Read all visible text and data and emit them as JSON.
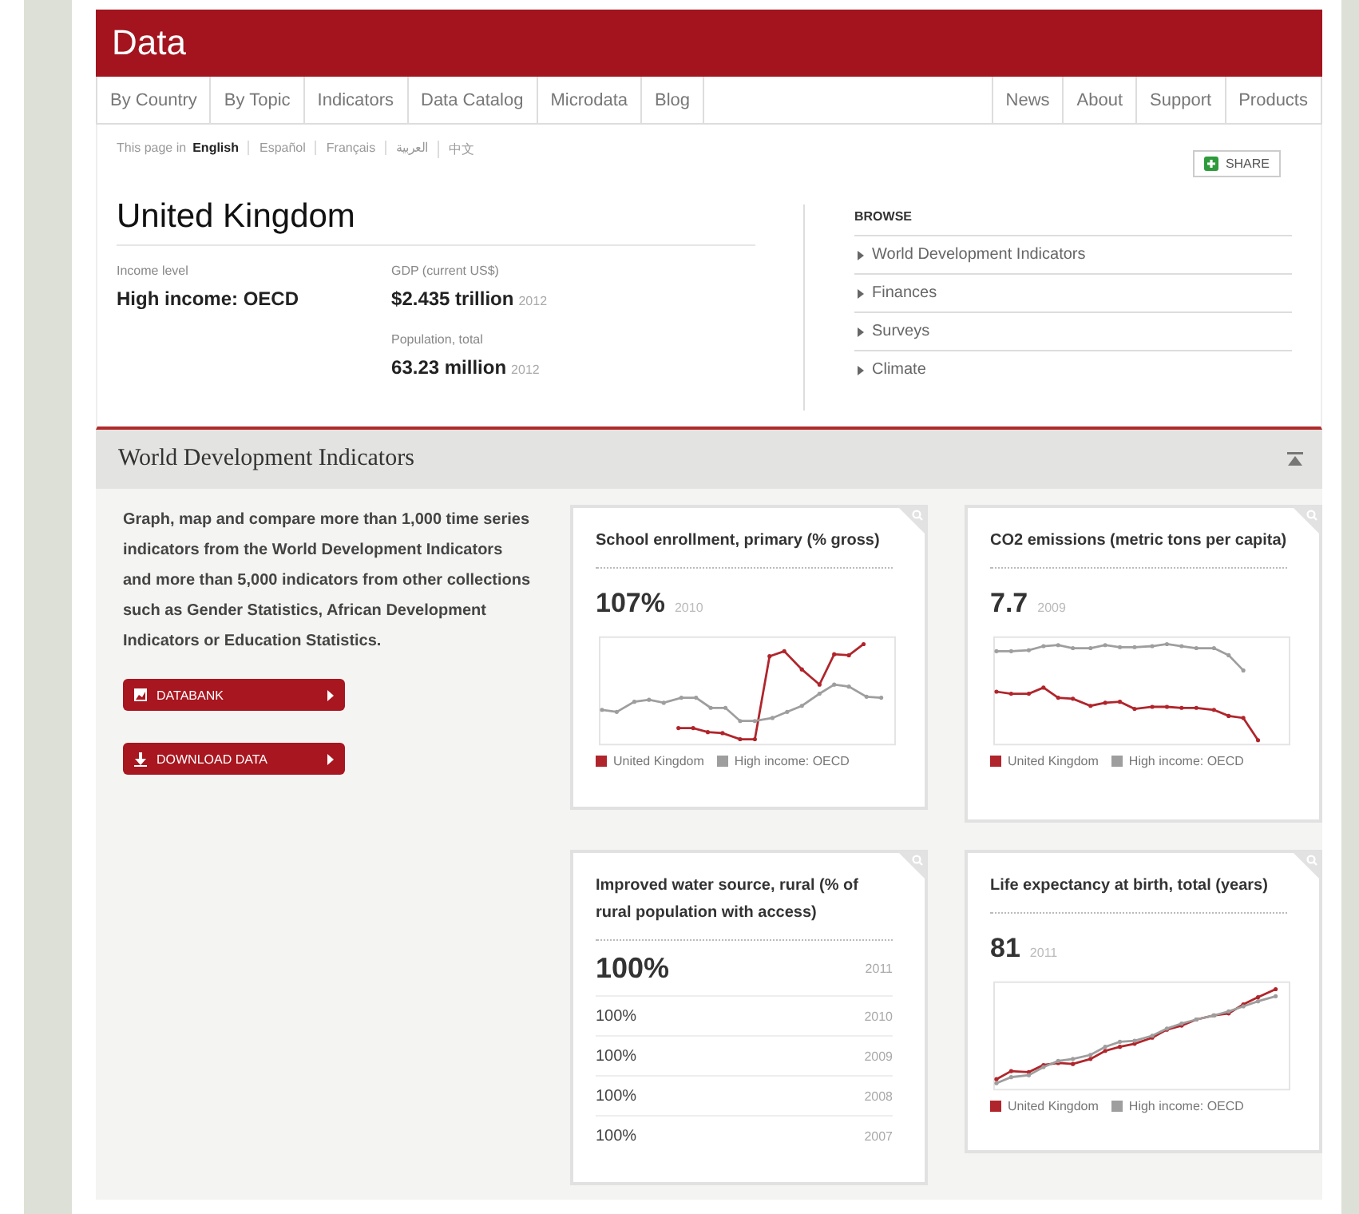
{
  "header": {
    "title": "Data"
  },
  "nav": {
    "left": [
      "By Country",
      "By Topic",
      "Indicators",
      "Data Catalog",
      "Microdata",
      "Blog"
    ],
    "right": [
      "News",
      "About",
      "Support",
      "Products"
    ]
  },
  "languages": {
    "label": "This page in",
    "items": [
      {
        "label": "English",
        "selected": true
      },
      {
        "label": "Español",
        "selected": false
      },
      {
        "label": "Français",
        "selected": false
      },
      {
        "label": "العربية",
        "selected": false
      },
      {
        "label": "中文",
        "selected": false
      }
    ]
  },
  "share": "SHARE",
  "country": {
    "name": "United Kingdom",
    "columns": [
      [
        {
          "label": "Income level",
          "value": "High income: OECD"
        }
      ],
      [
        {
          "label": "GDP (current US$)",
          "value": "$2.435 trillion",
          "year": "2012"
        },
        {
          "label": "Population, total",
          "value": "63.23 million",
          "year": "2012"
        }
      ]
    ]
  },
  "browse": {
    "title": "BROWSE",
    "items": [
      "World Development Indicators",
      "Finances",
      "Surveys",
      "Climate"
    ]
  },
  "section": {
    "title": "World Development Indicators",
    "expanded": true,
    "description": "Graph, map and compare more than 1,000 time series indicators from the World Development Indicators and more than 5,000 indicators from other collections such as Gender Statistics, African Development Indicators or Education Statistics.",
    "buttons": [
      {
        "label": "DATABANK",
        "kind": "databank"
      },
      {
        "label": "DOWNLOAD DATA",
        "kind": "download"
      }
    ],
    "cards": [
      {
        "kind": "chart",
        "title": "School enrollment, primary (% gross)",
        "value": "107%",
        "year": "2010",
        "legend": [
          {
            "label": "United Kingdom",
            "color": "#b0252b"
          },
          {
            "label": "High income: OECD",
            "color": "#9e9e9e"
          }
        ]
      },
      {
        "kind": "chart",
        "title": "CO2 emissions (metric tons per capita)",
        "value": "7.7",
        "year": "2009",
        "legend": [
          {
            "label": "United Kingdom",
            "color": "#b0252b"
          },
          {
            "label": "High income: OECD",
            "color": "#9e9e9e"
          }
        ]
      },
      {
        "kind": "list",
        "title": "Improved water source, rural (% of rural population with access)",
        "rows": [
          {
            "value": "100%",
            "year": "2011"
          },
          {
            "value": "100%",
            "year": "2010"
          },
          {
            "value": "100%",
            "year": "2009"
          },
          {
            "value": "100%",
            "year": "2008"
          },
          {
            "value": "100%",
            "year": "2007"
          }
        ]
      },
      {
        "kind": "chart",
        "title": "Life expectancy at birth, total (years)",
        "value": "81",
        "year": "2011",
        "legend": [
          {
            "label": "United Kingdom",
            "color": "#b0252b"
          },
          {
            "label": "High income: OECD",
            "color": "#9e9e9e"
          }
        ]
      }
    ]
  }
}
